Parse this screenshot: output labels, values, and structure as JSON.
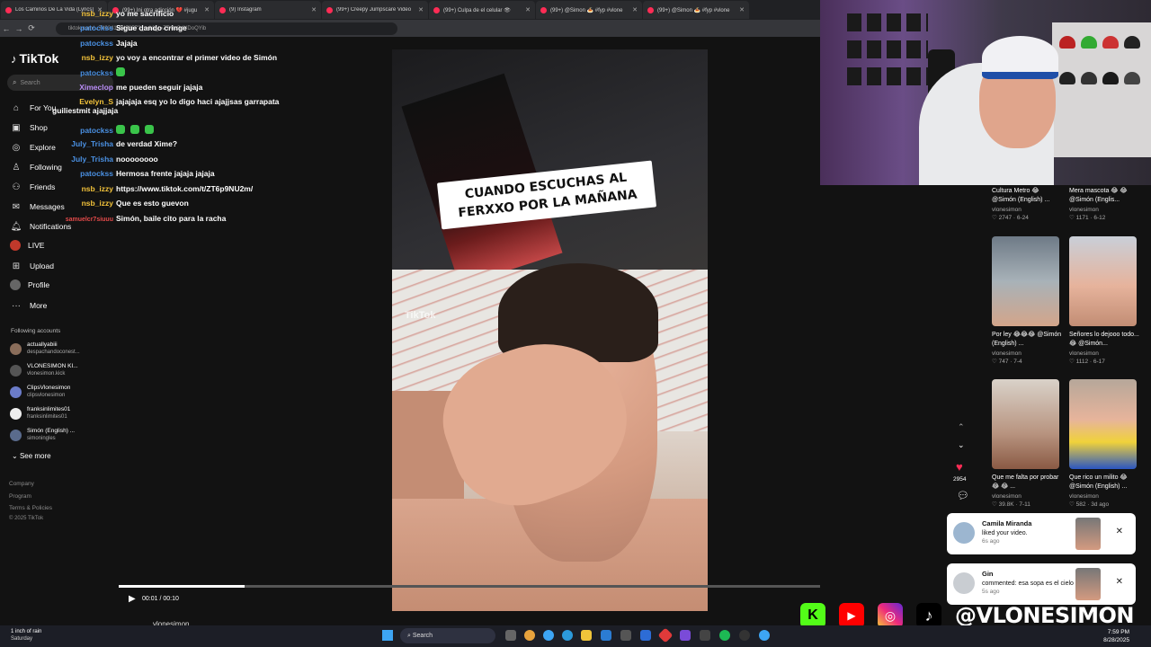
{
  "browser": {
    "tabs": [
      {
        "title": "Los Caminos De La Vida (Lyrics)"
      },
      {
        "title": "(99+) Ini otra adicción 💔 #jugu"
      },
      {
        "title": "(9) Instagram"
      },
      {
        "title": "(99+) Creepy Jumpscare Video"
      },
      {
        "title": "(99+) Culpa de el celular 👁"
      },
      {
        "title": "(99+) @Simon 🍝 #fyp #vlone"
      },
      {
        "title": "(99+) @Simon 🍝 #fyp #vlone"
      },
      {
        "title": "(99+) Simon 🍝 @Vlo"
      }
    ],
    "url": "tiktok.com/...7402415547357?_r=1&_t=ZT-8zGdYDoQYib"
  },
  "sidebar": {
    "logo": "TikTok",
    "search_placeholder": "Search",
    "nav": [
      {
        "label": "For You",
        "icon": "home-icon"
      },
      {
        "label": "Shop",
        "icon": "shop-icon"
      },
      {
        "label": "Explore",
        "icon": "compass-icon"
      },
      {
        "label": "Following",
        "icon": "following-icon"
      },
      {
        "label": "Friends",
        "icon": "friends-icon"
      },
      {
        "label": "Messages",
        "icon": "messages-icon"
      },
      {
        "label": "Notifications",
        "icon": "bell-icon"
      },
      {
        "label": "LIVE",
        "icon": "live-icon"
      },
      {
        "label": "Upload",
        "icon": "upload-icon"
      },
      {
        "label": "Profile",
        "icon": "profile-icon"
      },
      {
        "label": "More",
        "icon": "more-icon"
      }
    ],
    "following_header": "Following accounts",
    "accounts": [
      {
        "name": "actuallyabiii",
        "handle": "despachandoconest..."
      },
      {
        "name": "VLONESIMON KI...",
        "handle": "vlonesimon.kick"
      },
      {
        "name": "ClipsVlonesimon",
        "handle": "clipsvlonesimon"
      },
      {
        "name": "franksinlimites01",
        "handle": "franksinlimites01"
      },
      {
        "name": "Simón (English) ...",
        "handle": "simoningles"
      }
    ],
    "see_more": "See more",
    "footer": {
      "company": "Company",
      "program": "Program",
      "terms": "Terms & Policies",
      "copyright": "© 2025 TikTok"
    }
  },
  "chat": [
    {
      "user": "nsb_izzy",
      "color": "#f2c23a",
      "text": "yo me sacrificio"
    },
    {
      "user": "patockss",
      "color": "#4a90e2",
      "text": "Sigue dando cringe"
    },
    {
      "user": "patockss",
      "color": "#4a90e2",
      "text": "Jajaja"
    },
    {
      "user": "nsb_izzy",
      "color": "#f2c23a",
      "text": "yo voy a encontrar el primer video de Simón"
    },
    {
      "user": "patockss",
      "color": "#4a90e2",
      "text": ""
    },
    {
      "user": "Ximeclop",
      "color": "#b88cf5",
      "text": "me pueden seguir jajaja"
    },
    {
      "user": "Evelyn_S",
      "color": "#f2c23a",
      "text": "jajajaja esq yo lo digo haci ajajjsas garrapata guiliestmit ajajjaja"
    },
    {
      "user": "patockss",
      "color": "#4a90e2",
      "text": ""
    },
    {
      "user": "July_Trisha",
      "color": "#4a90e2",
      "text": "de verdad Xime?"
    },
    {
      "user": "July_Trisha",
      "color": "#4a90e2",
      "text": "noooooooo"
    },
    {
      "user": "patockss",
      "color": "#4a90e2",
      "text": "Hermosa frente jajaja jajaja"
    },
    {
      "user": "nsb_izzy",
      "color": "#f2c23a",
      "text": "https://www.tiktok.com/t/ZT6p9NU2m/"
    },
    {
      "user": "nsb_izzy",
      "color": "#f2c23a",
      "text": "Que es esto guevon"
    },
    {
      "user": "samuelcr7siuuu",
      "color": "#e24a4a",
      "text": "Simón, baile cito para la racha"
    }
  ],
  "video": {
    "caption": "CUANDO ESCUCHAS AL FERXXO POR LA MAÑANA",
    "watermark": "TikTok",
    "time": "00:01 / 00:10",
    "progress": 0.18,
    "author": "vlonesimon",
    "likes": "2954"
  },
  "related": [
    {
      "title": "Cultura Metro 😂 @Simón (English) ...",
      "account": "vlonesimon",
      "stats": "♡ 2747 · 6-24"
    },
    {
      "title": "Mera mascota 😂 😂 @Simón (Englis...",
      "account": "vlonesimon",
      "stats": "♡ 1171 · 6-12"
    },
    {
      "title": "Por ley 😂😂😂 @Simón (English) ...",
      "account": "vlonesimon",
      "stats": "♡ 747 · 7-4"
    },
    {
      "title": "Señores lo dejooo todo... 😂 @Simón...",
      "account": "vlonesimon",
      "stats": "♡ 1112 · 6-17"
    },
    {
      "title": "Que me falta por probar 😂 😂 ...",
      "account": "vlonesimon",
      "stats": "♡ 39.8K · 7-11"
    },
    {
      "title": "Que rico un milito 😂 @Simón (English) ...",
      "account": "vlonesimon",
      "stats": "♡ 582 · 3d ago"
    }
  ],
  "notifications": [
    {
      "name": "Camila Miranda",
      "text": "liked your video.",
      "ago": "6s ago"
    },
    {
      "name": "Gin",
      "text": "commented: esa sopa es el cielo",
      "ago": "5s ago"
    }
  ],
  "social": {
    "handle": "@VLONESIMON"
  },
  "taskbar": {
    "weather_title": "1 inch of rain",
    "weather_sub": "Saturday",
    "search": "Search",
    "time": "7:59 PM",
    "date": "8/28/2025"
  },
  "colors": {
    "accent": "#fe2c55",
    "background": "#121212"
  }
}
